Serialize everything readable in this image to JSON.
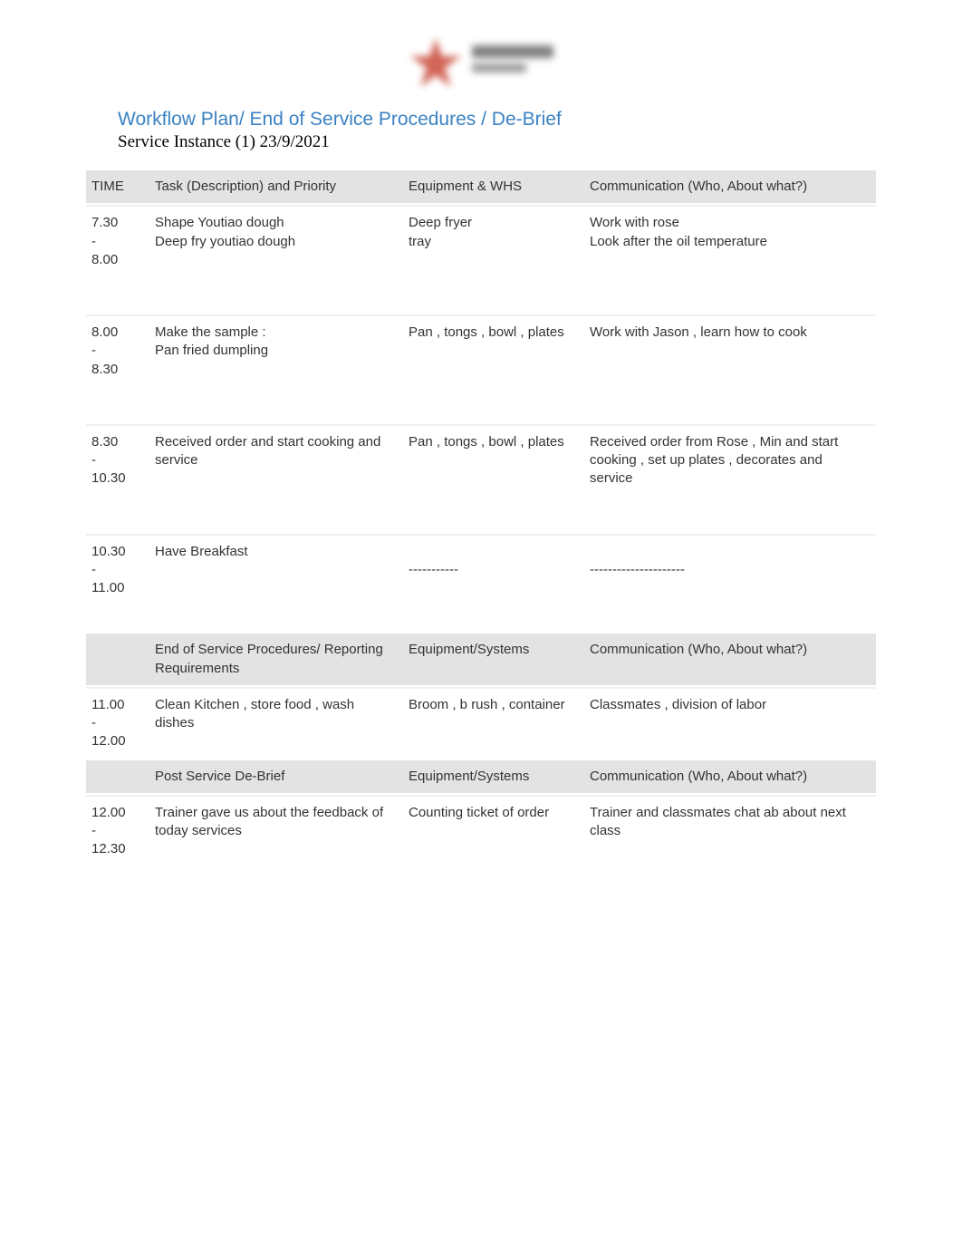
{
  "title": "Workflow Plan/ End of Service Procedures / De-Brief",
  "subtitle": "Service Instance (1)  23/9/2021",
  "headers": {
    "time": "TIME",
    "task": "Task (Description) and Priority",
    "equip": "Equipment & WHS",
    "comm": "Communication (Who, About what?)"
  },
  "rows": [
    {
      "time": "7.30\n-\n8.00",
      "task": "Shape Youtiao dough\nDeep fry youtiao dough",
      "equip": "Deep fryer\ntray",
      "comm": "Work with rose\nLook after the oil temperature"
    },
    {
      "time": "8.00\n-\n8.30",
      "task": "Make the sample :\nPan fried dumpling",
      "equip": "Pan , tongs , bowl , plates",
      "comm": "Work with Jason , learn how to cook"
    },
    {
      "time": "8.30\n-\n10.30",
      "task": "Received order and start cooking and service",
      "equip": "Pan , tongs , bowl , plates",
      "comm": "Received order from Rose , Min and start cooking , set up plates , decorates and service"
    },
    {
      "time": "10.30\n-\n11.00",
      "task": "Have Breakfast",
      "equip": "-----------",
      "comm": "---------------------"
    }
  ],
  "section2": {
    "header": {
      "task": "End of Service Procedures/ Reporting Requirements",
      "equip": "Equipment/Systems",
      "comm": "Communication (Who, About what?)"
    },
    "row": {
      "time": "11.00\n-\n12.00",
      "task": "Clean Kitchen , store food , wash dishes",
      "equip": "Broom , b rush , container",
      "comm": "Classmates , division of labor"
    }
  },
  "section3": {
    "header": {
      "task": "Post Service De-Brief",
      "equip": "Equipment/Systems",
      "comm": "Communication (Who, About what?)"
    },
    "row": {
      "time": "12.00\n-\n12.30",
      "task": "Trainer gave us about the feedback of today services",
      "equip": "Counting ticket of order",
      "comm": "Trainer and classmates chat ab about next class"
    }
  }
}
